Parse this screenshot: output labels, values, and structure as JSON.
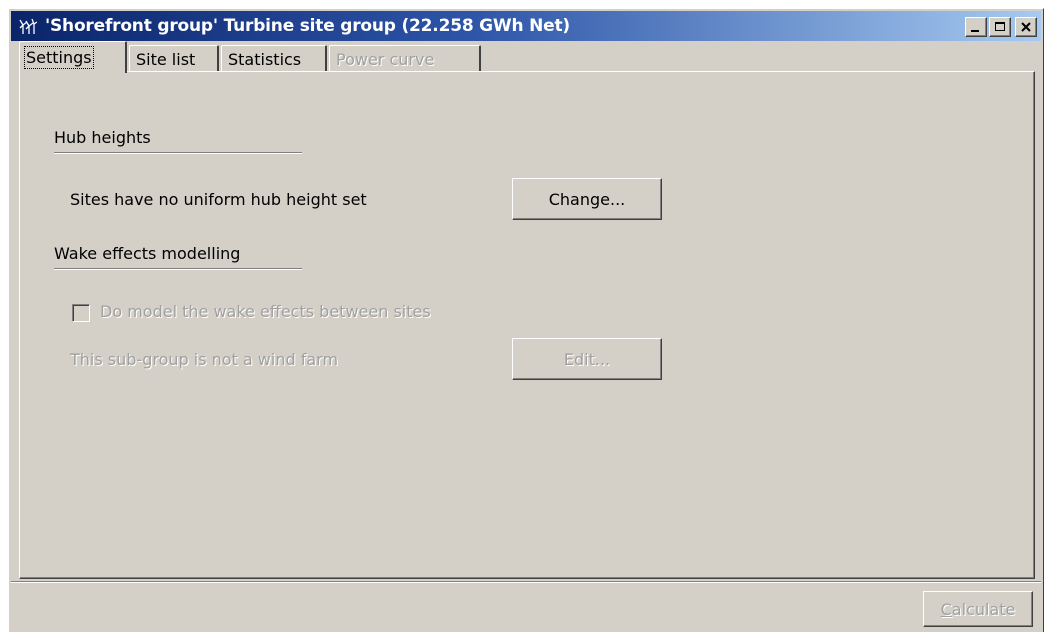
{
  "window": {
    "title": "'Shorefront group' Turbine site group (22.258 GWh Net)",
    "title_icon": "turbine-group-icon",
    "caption_buttons": [
      "minimize-icon",
      "maximize-icon",
      "close-icon"
    ]
  },
  "tabs": [
    {
      "label": "Settings",
      "state": "active"
    },
    {
      "label": "Site list",
      "state": "normal"
    },
    {
      "label": "Statistics",
      "state": "normal"
    },
    {
      "label": "Power curve",
      "state": "disabled"
    }
  ],
  "hub_heights": {
    "heading": "Hub heights",
    "status_text": "Sites have no uniform hub height set",
    "change_button": "Change..."
  },
  "wake_effects": {
    "heading": "Wake effects modelling",
    "checkbox_label": "Do model the wake effects between sites",
    "checkbox_checked": false,
    "note_text": "This sub-group is not a wind farm",
    "edit_button": "Edit..."
  },
  "footer": {
    "calculate_first": "C",
    "calculate_rest": "alculate"
  },
  "colors": {
    "face": "#d4d0c8",
    "title_start": "#0a246a",
    "title_end": "#a6caf0",
    "disabled_text": "#a0a0a0"
  }
}
